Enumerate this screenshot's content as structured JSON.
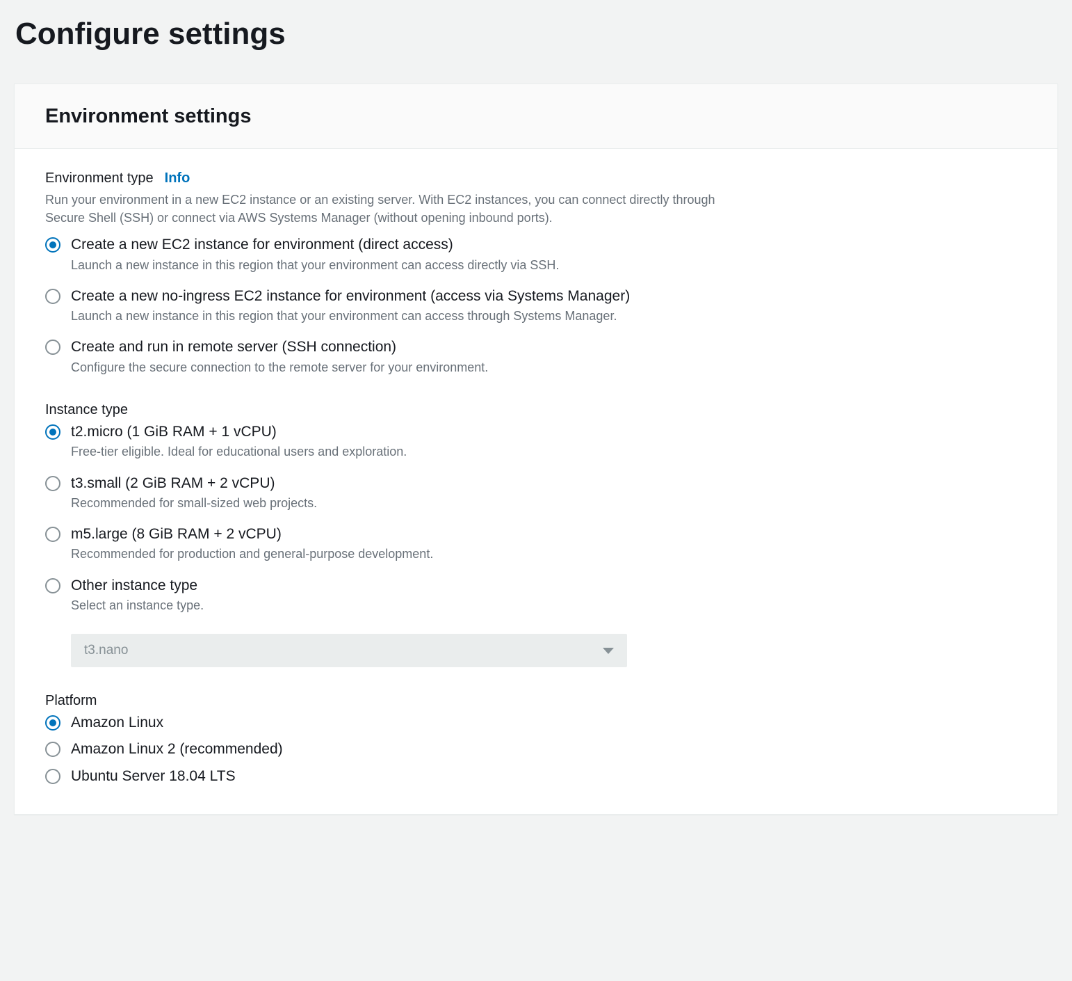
{
  "page": {
    "title": "Configure settings"
  },
  "panel": {
    "header": "Environment settings"
  },
  "env_type": {
    "title": "Environment type",
    "info": "Info",
    "desc": "Run your environment in a new EC2 instance or an existing server. With EC2 instances, you can connect directly through Secure Shell (SSH) or connect via AWS Systems Manager (without opening inbound ports).",
    "options": [
      {
        "label": "Create a new EC2 instance for environment (direct access)",
        "sub": "Launch a new instance in this region that your environment can access directly via SSH.",
        "selected": true
      },
      {
        "label": "Create a new no-ingress EC2 instance for environment (access via Systems Manager)",
        "sub": "Launch a new instance in this region that your environment can access through Systems Manager.",
        "selected": false
      },
      {
        "label": "Create and run in remote server (SSH connection)",
        "sub": "Configure the secure connection to the remote server for your environment.",
        "selected": false
      }
    ]
  },
  "instance_type": {
    "title": "Instance type",
    "options": [
      {
        "label": "t2.micro (1 GiB RAM + 1 vCPU)",
        "sub": "Free-tier eligible. Ideal for educational users and exploration.",
        "selected": true
      },
      {
        "label": "t3.small (2 GiB RAM + 2 vCPU)",
        "sub": "Recommended for small-sized web projects.",
        "selected": false
      },
      {
        "label": "m5.large (8 GiB RAM + 2 vCPU)",
        "sub": "Recommended for production and general-purpose development.",
        "selected": false
      },
      {
        "label": "Other instance type",
        "sub": "Select an instance type.",
        "selected": false
      }
    ],
    "other_select": {
      "value": "t3.nano",
      "disabled": true
    }
  },
  "platform": {
    "title": "Platform",
    "options": [
      {
        "label": "Amazon Linux",
        "selected": true
      },
      {
        "label": "Amazon Linux 2 (recommended)",
        "selected": false
      },
      {
        "label": "Ubuntu Server 18.04 LTS",
        "selected": false
      }
    ]
  }
}
